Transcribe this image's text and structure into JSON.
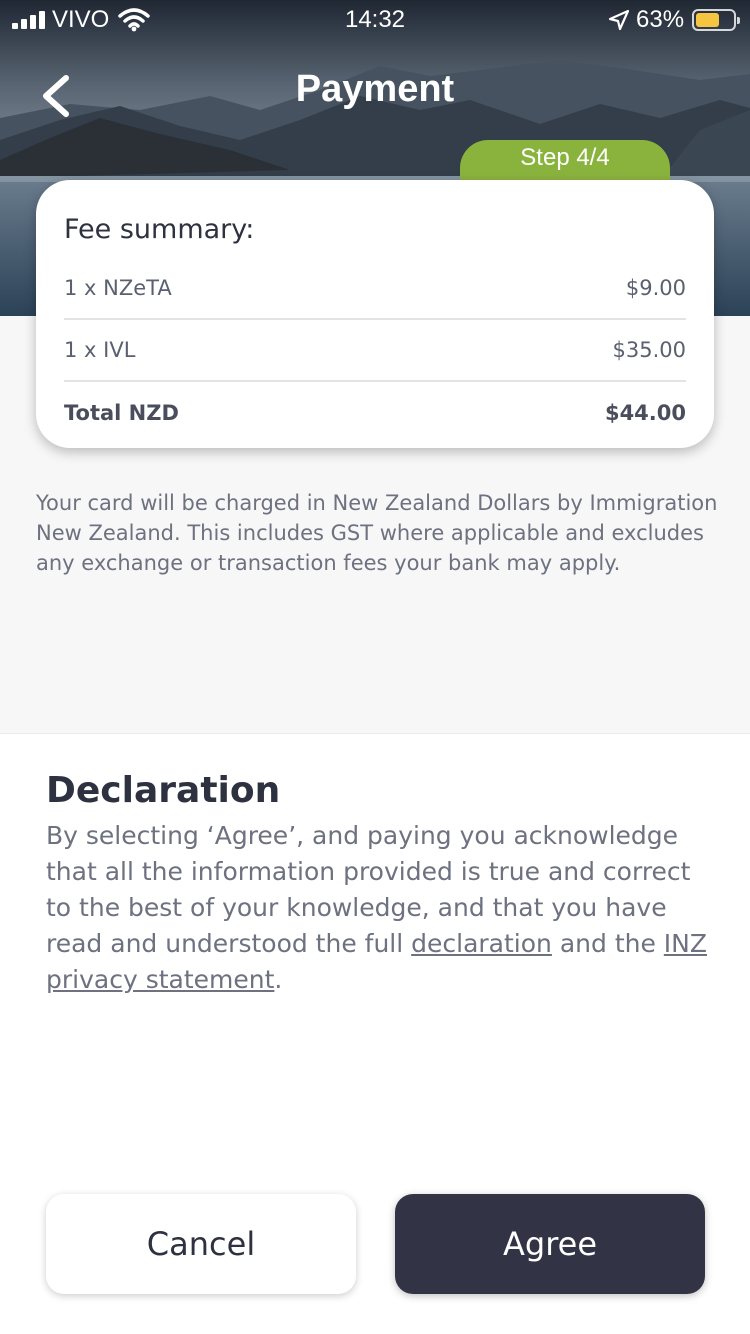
{
  "status_bar": {
    "carrier": "VIVO",
    "time": "14:32",
    "battery_percent": "63%",
    "battery_level": 0.63,
    "icons": [
      "signal-icon",
      "wifi-icon",
      "location-icon",
      "battery-icon"
    ]
  },
  "header": {
    "title": "Payment",
    "back_icon": "chevron-left-icon",
    "step_label": "Step 4/4"
  },
  "fee_summary": {
    "heading": "Fee summary:",
    "items": [
      {
        "label": "1 x NZeTA",
        "amount": "$9.00"
      },
      {
        "label": "1 x IVL",
        "amount": "$35.00"
      }
    ],
    "total": {
      "label": "Total NZD",
      "amount": "$44.00"
    }
  },
  "note": "Your card will be charged in New Zealand Dollars by Immigration New Zealand. This includes GST where applicable and excludes any exchange or transaction fees your bank may apply.",
  "declaration": {
    "heading": "Declaration",
    "text_before": "By selecting ‘Agree’, and paying you acknowledge that all the information provided is true and correct to the best of your knowledge, and that you have read and understood the full ",
    "link_declaration": "declaration",
    "text_middle": " and the ",
    "link_privacy": "INZ privacy statement",
    "text_after": "."
  },
  "buttons": {
    "cancel": "Cancel",
    "agree": "Agree"
  },
  "colors": {
    "step_green": "#8ab33e",
    "primary_dark": "#323445",
    "battery_yellow": "#f5c542"
  }
}
